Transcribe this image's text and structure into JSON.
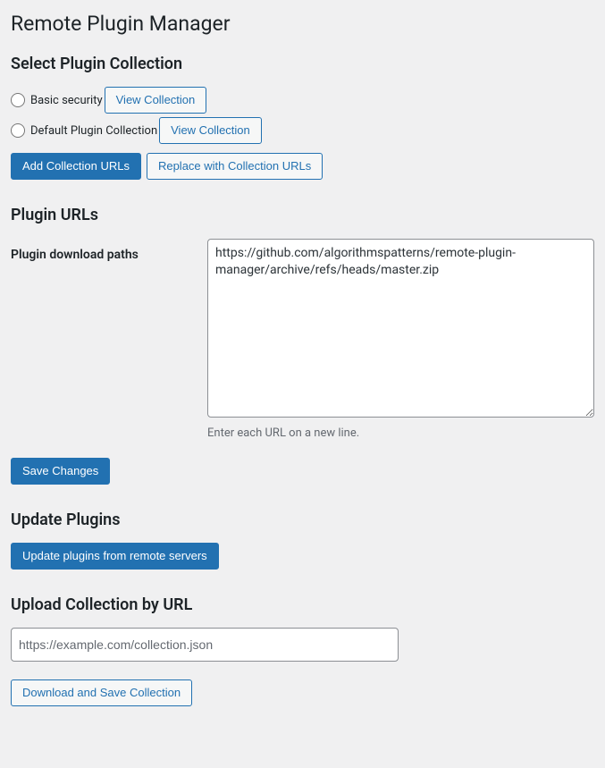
{
  "page_title": "Remote Plugin Manager",
  "select_collection": {
    "heading": "Select Plugin Collection",
    "options": [
      {
        "label": "Basic security",
        "view_label": "View Collection"
      },
      {
        "label": "Default Plugin Collection",
        "view_label": "View Collection"
      }
    ],
    "add_button": "Add Collection URLs",
    "replace_button": "Replace with Collection URLs"
  },
  "plugin_urls": {
    "heading": "Plugin URLs",
    "field_label": "Plugin download paths",
    "textarea_value": "https://github.com/algorithmspatterns/remote-plugin-manager/archive/refs/heads/master.zip",
    "description": "Enter each URL on a new line.",
    "save_button": "Save Changes"
  },
  "update_plugins": {
    "heading": "Update Plugins",
    "button": "Update plugins from remote servers"
  },
  "upload_collection": {
    "heading": "Upload Collection by URL",
    "placeholder": "https://example.com/collection.json",
    "button": "Download and Save Collection"
  }
}
